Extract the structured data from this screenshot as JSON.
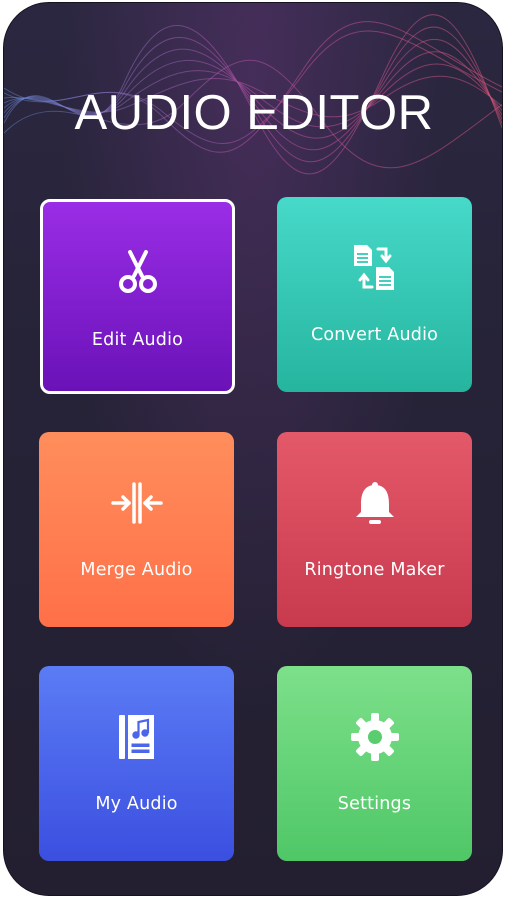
{
  "app": {
    "title": "AUDIO EDITOR"
  },
  "tiles": [
    {
      "label": "Edit Audio",
      "icon": "scissors-icon",
      "color": "#8a22d6",
      "selected": true
    },
    {
      "label": "Convert Audio",
      "icon": "convert-files-icon",
      "color": "#36c8b4"
    },
    {
      "label": "Merge Audio",
      "icon": "merge-icon",
      "color": "#ff7d52"
    },
    {
      "label": "Ringtone Maker",
      "icon": "bell-icon",
      "color": "#d6495c"
    },
    {
      "label": "My Audio",
      "icon": "music-book-icon",
      "color": "#4b66ea"
    },
    {
      "label": "Settings",
      "icon": "gear-icon",
      "color": "#66d478"
    }
  ]
}
